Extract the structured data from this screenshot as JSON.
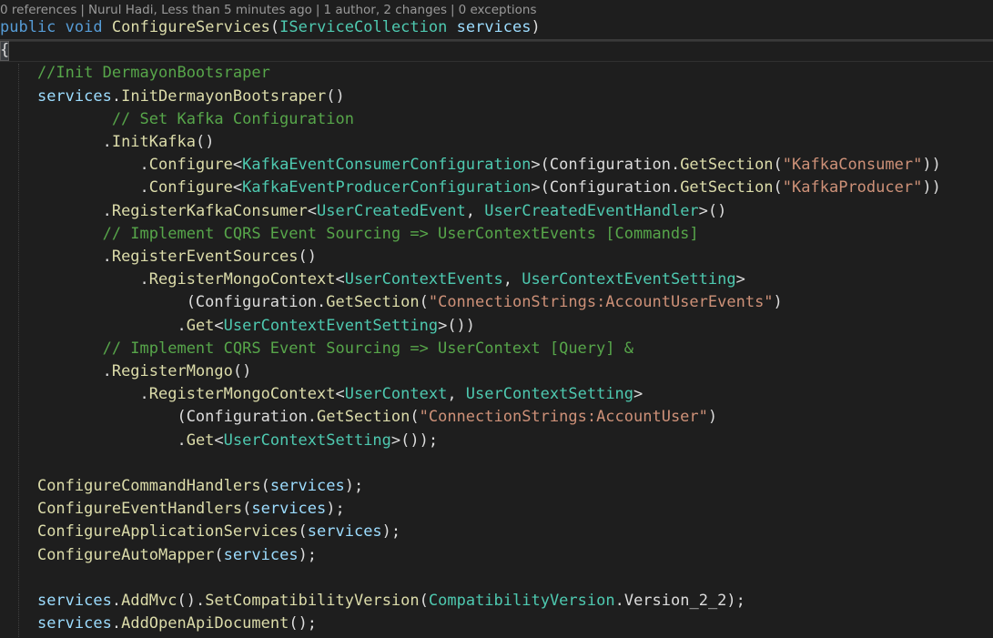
{
  "codelens": {
    "references": "0 references",
    "author": "Nurul Hadi, Less than 5 minutes ago",
    "changes": "1 author, 2 changes",
    "exceptions": "0 exceptions",
    "separator": "|"
  },
  "colors": {
    "background": "#1e1e1e",
    "keyword": "#569cd6",
    "method": "#dcdcaa",
    "type": "#4ec9b0",
    "parameter": "#9cdcfe",
    "string": "#ce9178",
    "comment": "#57a64a",
    "default": "#dcdcdc"
  },
  "lines": [
    [
      {
        "t": "public",
        "c": "kw"
      },
      {
        "t": " ",
        "c": "df"
      },
      {
        "t": "void",
        "c": "kw"
      },
      {
        "t": " ",
        "c": "df"
      },
      {
        "t": "ConfigureServices",
        "c": "fn"
      },
      {
        "t": "(",
        "c": "df"
      },
      {
        "t": "IServiceCollection",
        "c": "ty"
      },
      {
        "t": " ",
        "c": "df"
      },
      {
        "t": "services",
        "c": "pa"
      },
      {
        "t": ")",
        "c": "df"
      }
    ],
    [
      {
        "t": "{",
        "c": "df"
      }
    ],
    [
      {
        "t": "    //Init DermayonBootsraper",
        "c": "cm"
      }
    ],
    [
      {
        "t": "    ",
        "c": "df"
      },
      {
        "t": "services",
        "c": "pa"
      },
      {
        "t": ".",
        "c": "df"
      },
      {
        "t": "InitDermayonBootsraper",
        "c": "fn"
      },
      {
        "t": "()",
        "c": "df"
      }
    ],
    [
      {
        "t": "            // Set Kafka Configuration",
        "c": "cm"
      }
    ],
    [
      {
        "t": "           .",
        "c": "df"
      },
      {
        "t": "InitKafka",
        "c": "fn"
      },
      {
        "t": "()",
        "c": "df"
      }
    ],
    [
      {
        "t": "               .",
        "c": "df"
      },
      {
        "t": "Configure",
        "c": "fn"
      },
      {
        "t": "<",
        "c": "df"
      },
      {
        "t": "KafkaEventConsumerConfiguration",
        "c": "ty"
      },
      {
        "t": ">(Configuration.",
        "c": "df"
      },
      {
        "t": "GetSection",
        "c": "fn"
      },
      {
        "t": "(",
        "c": "df"
      },
      {
        "t": "\"KafkaConsumer\"",
        "c": "st"
      },
      {
        "t": "))",
        "c": "df"
      }
    ],
    [
      {
        "t": "               .",
        "c": "df"
      },
      {
        "t": "Configure",
        "c": "fn"
      },
      {
        "t": "<",
        "c": "df"
      },
      {
        "t": "KafkaEventProducerConfiguration",
        "c": "ty"
      },
      {
        "t": ">(Configuration.",
        "c": "df"
      },
      {
        "t": "GetSection",
        "c": "fn"
      },
      {
        "t": "(",
        "c": "df"
      },
      {
        "t": "\"KafkaProducer\"",
        "c": "st"
      },
      {
        "t": "))",
        "c": "df"
      }
    ],
    [
      {
        "t": "           .",
        "c": "df"
      },
      {
        "t": "RegisterKafkaConsumer",
        "c": "fn"
      },
      {
        "t": "<",
        "c": "df"
      },
      {
        "t": "UserCreatedEvent",
        "c": "ty"
      },
      {
        "t": ", ",
        "c": "df"
      },
      {
        "t": "UserCreatedEventHandler",
        "c": "ty"
      },
      {
        "t": ">()",
        "c": "df"
      }
    ],
    [
      {
        "t": "           // Implement CQRS Event Sourcing => UserContextEvents [Commands]",
        "c": "cm"
      }
    ],
    [
      {
        "t": "           .",
        "c": "df"
      },
      {
        "t": "RegisterEventSources",
        "c": "fn"
      },
      {
        "t": "()",
        "c": "df"
      }
    ],
    [
      {
        "t": "               .",
        "c": "df"
      },
      {
        "t": "RegisterMongoContext",
        "c": "fn"
      },
      {
        "t": "<",
        "c": "df"
      },
      {
        "t": "UserContextEvents",
        "c": "ty"
      },
      {
        "t": ", ",
        "c": "df"
      },
      {
        "t": "UserContextEventSetting",
        "c": "ty"
      },
      {
        "t": ">",
        "c": "df"
      }
    ],
    [
      {
        "t": "                    (Configuration.",
        "c": "df"
      },
      {
        "t": "GetSection",
        "c": "fn"
      },
      {
        "t": "(",
        "c": "df"
      },
      {
        "t": "\"ConnectionStrings:AccountUserEvents\"",
        "c": "st"
      },
      {
        "t": ")",
        "c": "df"
      }
    ],
    [
      {
        "t": "                   .",
        "c": "df"
      },
      {
        "t": "Get",
        "c": "fn"
      },
      {
        "t": "<",
        "c": "df"
      },
      {
        "t": "UserContextEventSetting",
        "c": "ty"
      },
      {
        "t": ">())",
        "c": "df"
      }
    ],
    [
      {
        "t": "           // Implement CQRS Event Sourcing => UserContext [Query] &",
        "c": "cm"
      }
    ],
    [
      {
        "t": "           .",
        "c": "df"
      },
      {
        "t": "RegisterMongo",
        "c": "fn"
      },
      {
        "t": "()",
        "c": "df"
      }
    ],
    [
      {
        "t": "               .",
        "c": "df"
      },
      {
        "t": "RegisterMongoContext",
        "c": "fn"
      },
      {
        "t": "<",
        "c": "df"
      },
      {
        "t": "UserContext",
        "c": "ty"
      },
      {
        "t": ", ",
        "c": "df"
      },
      {
        "t": "UserContextSetting",
        "c": "ty"
      },
      {
        "t": ">",
        "c": "df"
      }
    ],
    [
      {
        "t": "                   (Configuration.",
        "c": "df"
      },
      {
        "t": "GetSection",
        "c": "fn"
      },
      {
        "t": "(",
        "c": "df"
      },
      {
        "t": "\"ConnectionStrings:AccountUser\"",
        "c": "st"
      },
      {
        "t": ")",
        "c": "df"
      }
    ],
    [
      {
        "t": "                   .",
        "c": "df"
      },
      {
        "t": "Get",
        "c": "fn"
      },
      {
        "t": "<",
        "c": "df"
      },
      {
        "t": "UserContextSetting",
        "c": "ty"
      },
      {
        "t": ">());",
        "c": "df"
      }
    ],
    [],
    [
      {
        "t": "    ",
        "c": "df"
      },
      {
        "t": "ConfigureCommandHandlers",
        "c": "fn"
      },
      {
        "t": "(",
        "c": "df"
      },
      {
        "t": "services",
        "c": "pa"
      },
      {
        "t": ");",
        "c": "df"
      }
    ],
    [
      {
        "t": "    ",
        "c": "df"
      },
      {
        "t": "ConfigureEventHandlers",
        "c": "fn"
      },
      {
        "t": "(",
        "c": "df"
      },
      {
        "t": "services",
        "c": "pa"
      },
      {
        "t": ");",
        "c": "df"
      }
    ],
    [
      {
        "t": "    ",
        "c": "df"
      },
      {
        "t": "ConfigureApplicationServices",
        "c": "fn"
      },
      {
        "t": "(",
        "c": "df"
      },
      {
        "t": "services",
        "c": "pa"
      },
      {
        "t": ");",
        "c": "df"
      }
    ],
    [
      {
        "t": "    ",
        "c": "df"
      },
      {
        "t": "ConfigureAutoMapper",
        "c": "fn"
      },
      {
        "t": "(",
        "c": "df"
      },
      {
        "t": "services",
        "c": "pa"
      },
      {
        "t": ");",
        "c": "df"
      }
    ],
    [],
    [
      {
        "t": "    ",
        "c": "df"
      },
      {
        "t": "services",
        "c": "pa"
      },
      {
        "t": ".",
        "c": "df"
      },
      {
        "t": "AddMvc",
        "c": "fn"
      },
      {
        "t": "().",
        "c": "df"
      },
      {
        "t": "SetCompatibilityVersion",
        "c": "fn"
      },
      {
        "t": "(",
        "c": "df"
      },
      {
        "t": "CompatibilityVersion",
        "c": "ty"
      },
      {
        "t": ".Version_2_2);",
        "c": "df"
      }
    ],
    [
      {
        "t": "    ",
        "c": "df"
      },
      {
        "t": "services",
        "c": "pa"
      },
      {
        "t": ".",
        "c": "df"
      },
      {
        "t": "AddOpenApiDocument",
        "c": "fn"
      },
      {
        "t": "();",
        "c": "df"
      }
    ]
  ]
}
